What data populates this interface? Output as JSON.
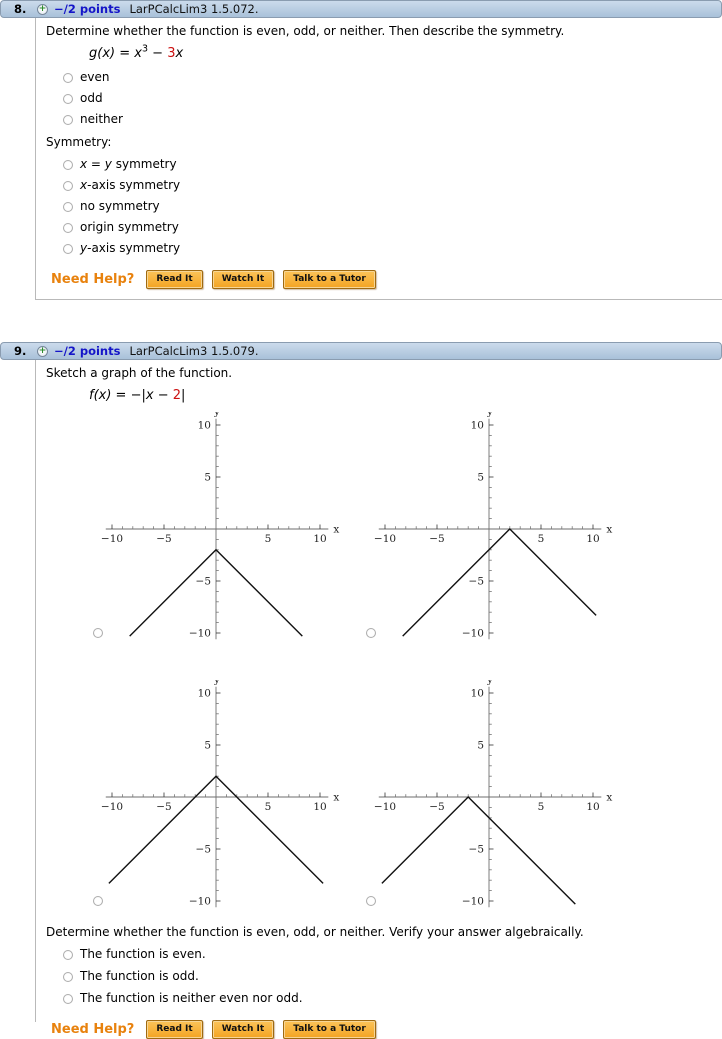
{
  "problems": [
    {
      "number": "8.",
      "points": "−/2 points",
      "source": "LarPCalcLim3 1.5.072.",
      "prompt": "Determine whether the function is even, odd, or neither. Then describe the symmetry.",
      "formula": {
        "name": "g(x)",
        "eq": " = ",
        "base": "x",
        "exp": "3",
        "op": " − ",
        "coef": "3",
        "var": "x"
      },
      "parity_options": [
        "even",
        "odd",
        "neither"
      ],
      "symmetry_label": "Symmetry:",
      "symmetry_options": [
        {
          "i1": "x",
          "mid": " = ",
          "i2": "y",
          "rest": " symmetry"
        },
        {
          "i1": "x",
          "rest": "-axis symmetry"
        },
        {
          "rest": "no symmetry"
        },
        {
          "rest": "origin symmetry"
        },
        {
          "i1": "y",
          "rest": "-axis symmetry"
        }
      ],
      "need_help": {
        "label": "Need Help?",
        "buttons": [
          "Read It",
          "Watch It",
          "Talk to a Tutor"
        ]
      }
    },
    {
      "number": "9.",
      "points": "−/2 points",
      "source": "LarPCalcLim3 1.5.079.",
      "prompt": "Sketch a graph of the function.",
      "formula": {
        "name": "f(x)",
        "eq": " = −|",
        "var": "x",
        "op": " − ",
        "num": "2",
        "bar": "|"
      },
      "prompt2": "Determine whether the function is even, odd, or neither. Verify your answer algebraically.",
      "parity_options": [
        "The function is even.",
        "The function is odd.",
        "The function is neither even nor odd."
      ],
      "need_help": {
        "label": "Need Help?",
        "buttons": [
          "Read It",
          "Watch It",
          "Talk to a Tutor"
        ]
      }
    }
  ],
  "chart_data": [
    {
      "type": "line",
      "depicts": "y = −|x| − 2",
      "points": [
        [
          -8.3,
          -10.3
        ],
        [
          0,
          -2
        ],
        [
          8.3,
          -10.3
        ]
      ],
      "axis": {
        "xlabel": "x",
        "ylabel": "y",
        "x_extent": [
          -10.6,
          10.8
        ],
        "y_extent": [
          -10.6,
          10.6
        ],
        "labeled_ticks": [
          -10,
          -5,
          5,
          10
        ],
        "minor_tick_step": 1,
        "xlim": [
          -10,
          10
        ],
        "ylim": [
          -10,
          10
        ]
      }
    },
    {
      "type": "line",
      "depicts": "y = −|x − 2|",
      "points": [
        [
          -8.3,
          -10.3
        ],
        [
          2,
          0
        ],
        [
          10.3,
          -8.3
        ]
      ],
      "axis": {
        "xlabel": "x",
        "ylabel": "y",
        "x_extent": [
          -10.6,
          10.8
        ],
        "y_extent": [
          -10.6,
          10.6
        ],
        "labeled_ticks": [
          -10,
          -5,
          5,
          10
        ],
        "minor_tick_step": 1,
        "xlim": [
          -10,
          10
        ],
        "ylim": [
          -10,
          10
        ]
      }
    },
    {
      "type": "line",
      "depicts": "y = −|x| + 2",
      "points": [
        [
          -10.3,
          -8.3
        ],
        [
          0,
          2
        ],
        [
          10.3,
          -8.3
        ]
      ],
      "axis": {
        "xlabel": "x",
        "ylabel": "y",
        "x_extent": [
          -10.6,
          10.8
        ],
        "y_extent": [
          -10.6,
          10.6
        ],
        "labeled_ticks": [
          -10,
          -5,
          5,
          10
        ],
        "minor_tick_step": 1,
        "xlim": [
          -10,
          10
        ],
        "ylim": [
          -10,
          10
        ]
      }
    },
    {
      "type": "line",
      "depicts": "y = −|x + 2|",
      "points": [
        [
          -10.3,
          -8.3
        ],
        [
          -2,
          0
        ],
        [
          8.3,
          -10.3
        ]
      ],
      "axis": {
        "xlabel": "x",
        "ylabel": "y",
        "x_extent": [
          -10.6,
          10.8
        ],
        "y_extent": [
          -10.6,
          10.6
        ],
        "labeled_ticks": [
          -10,
          -5,
          5,
          10
        ],
        "minor_tick_step": 1,
        "xlim": [
          -10,
          10
        ],
        "ylim": [
          -10,
          10
        ]
      }
    }
  ]
}
